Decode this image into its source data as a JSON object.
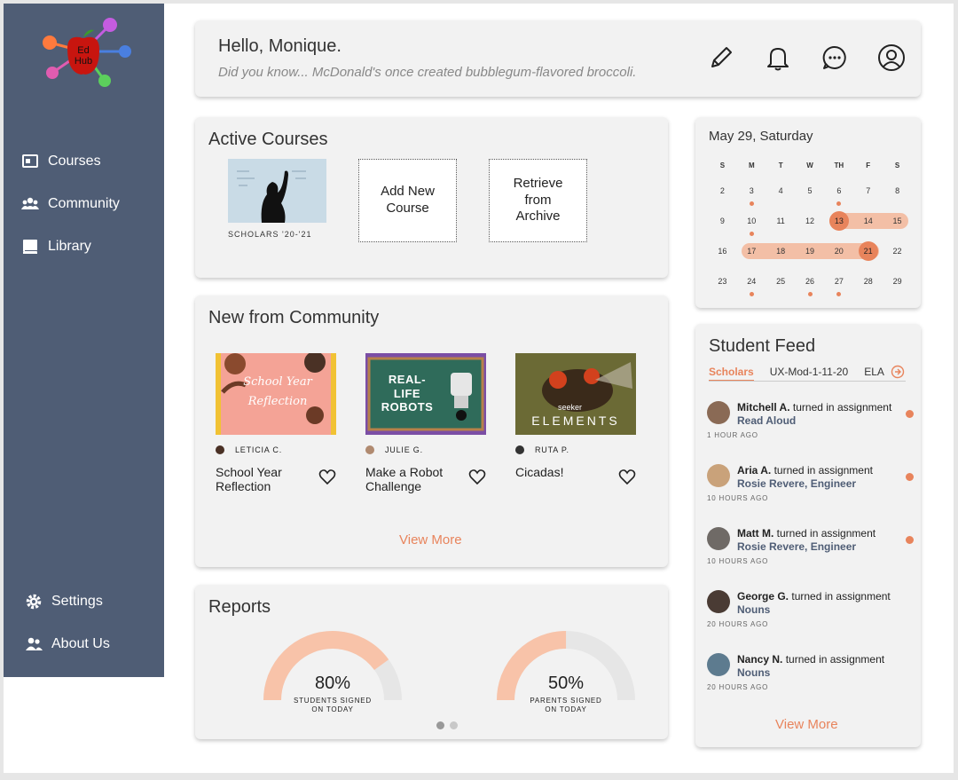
{
  "app": {
    "logo_text_1": "Ed",
    "logo_text_2": "Hub"
  },
  "sidebar": {
    "items": [
      {
        "label": "Courses",
        "icon": "courses-icon"
      },
      {
        "label": "Community",
        "icon": "community-icon"
      },
      {
        "label": "Library",
        "icon": "library-icon"
      }
    ],
    "bottom_items": [
      {
        "label": "Settings",
        "icon": "gear-icon"
      },
      {
        "label": "About Us",
        "icon": "users-icon"
      }
    ]
  },
  "header": {
    "greeting": "Hello, Monique.",
    "fact": "Did you know... McDonald's once created bubblegum-flavored broccoli.",
    "icons": [
      "pencil-icon",
      "bell-icon",
      "chat-icon",
      "profile-icon"
    ]
  },
  "active_courses": {
    "title": "Active Courses",
    "course_label": "SCHOLARS '20-'21",
    "add_label": "Add New Course",
    "retrieve_label": "Retrieve from Archive"
  },
  "community": {
    "title": "New from Community",
    "items": [
      {
        "author": "LETICIA C.",
        "title": "School Year Reflection",
        "image_text": "School Year Reflection"
      },
      {
        "author": "JULIE G.",
        "title": "Make a Robot Challenge",
        "image_text": "REAL-LIFE ROBOTS"
      },
      {
        "author": "RUTA P.",
        "title": "Cicadas!",
        "image_text": "ELEMENTS",
        "image_subtext": "seeker"
      }
    ],
    "view_more": "View More"
  },
  "reports": {
    "title": "Reports",
    "gauges": [
      {
        "value": 80,
        "percent_text": "80%",
        "label_1": "STUDENTS SIGNED",
        "label_2": "ON TODAY"
      },
      {
        "value": 50,
        "percent_text": "50%",
        "label_1": "PARENTS SIGNED",
        "label_2": "ON TODAY"
      }
    ],
    "pages": 2,
    "active_page": 1
  },
  "calendar": {
    "date": "May 29, Saturday",
    "weekdays": [
      "S",
      "M",
      "T",
      "W",
      "TH",
      "F",
      "S"
    ],
    "weeks": [
      [
        "2",
        "3",
        "4",
        "5",
        "6",
        "7",
        "8"
      ],
      [
        "9",
        "10",
        "11",
        "12",
        "13",
        "14",
        "15"
      ],
      [
        "16",
        "17",
        "18",
        "19",
        "20",
        "21",
        "22"
      ],
      [
        "23",
        "24",
        "25",
        "26",
        "27",
        "28",
        "29"
      ]
    ],
    "event_days": [
      "3",
      "6",
      "10",
      "24",
      "26",
      "27"
    ],
    "selected_days": [
      "13",
      "21"
    ],
    "range_days": [
      "13",
      "14",
      "15",
      "17",
      "18",
      "19",
      "20",
      "21"
    ]
  },
  "feed": {
    "title": "Student Feed",
    "tabs": [
      "Scholars",
      "UX-Mod-1-11-20",
      "ELA"
    ],
    "active_tab": "Scholars",
    "action_text": "turned in assignment",
    "items": [
      {
        "name": "Mitchell A.",
        "assignment": "Read Aloud",
        "time": "1 HOUR AGO",
        "unread": true,
        "avatar_color": "#8a6a55"
      },
      {
        "name": "Aria A.",
        "assignment": "Rosie Revere, Engineer",
        "time": "10 HOURS AGO",
        "unread": true,
        "avatar_color": "#c9a27a"
      },
      {
        "name": "Matt M.",
        "assignment": "Rosie Revere, Engineer",
        "time": "10 HOURS AGO",
        "unread": true,
        "avatar_color": "#6f6a66"
      },
      {
        "name": "George G.",
        "assignment": "Nouns",
        "time": "20 HOURS AGO",
        "unread": false,
        "avatar_color": "#4a3b34"
      },
      {
        "name": "Nancy N.",
        "assignment": "Nouns",
        "time": "20 HOURS AGO",
        "unread": false,
        "avatar_color": "#5d7b8f"
      }
    ],
    "view_more": "View More"
  },
  "colors": {
    "sidebar": "#4f5d75",
    "accent": "#e8845c",
    "accent_light": "#f3bfa6",
    "card": "#f2f2f2"
  }
}
